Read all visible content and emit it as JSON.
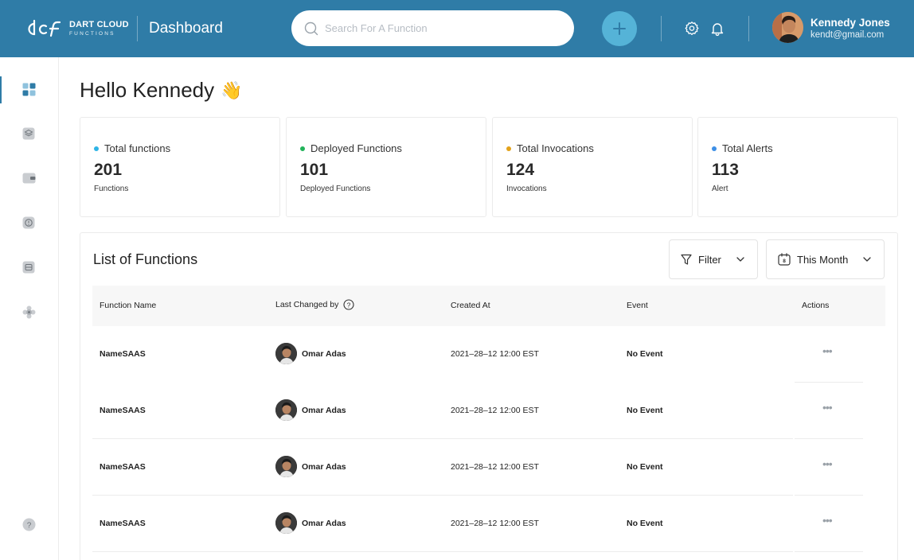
{
  "brand": {
    "line1": "DART CLOUD",
    "line2": "FUNCTIONS"
  },
  "header": {
    "page_title": "Dashboard",
    "search_placeholder": "Search For A Function",
    "user_name": "Kennedy Jones",
    "user_email": "kendt@gmail.com"
  },
  "sidebar": {
    "items": [
      {
        "icon": "dashboard-grid-icon",
        "active": true
      },
      {
        "icon": "layers-icon"
      },
      {
        "icon": "wallet-icon"
      },
      {
        "icon": "alert-circle-icon"
      },
      {
        "icon": "database-icon"
      },
      {
        "icon": "settings-cog-icon"
      },
      {
        "icon": "help-icon"
      }
    ]
  },
  "greeting": {
    "text": "Hello Kennedy",
    "emoji": "👋"
  },
  "stats": [
    {
      "title": "Total functions",
      "value": "201",
      "sub": "Functions",
      "color": "#2eb4e6"
    },
    {
      "title": "Deployed Functions",
      "value": "101",
      "sub": "Deployed Functions",
      "color": "#22b35a"
    },
    {
      "title": "Total Invocations",
      "value": "124",
      "sub": "Invocations",
      "color": "#e3a21a"
    },
    {
      "title": "Total Alerts",
      "value": "113",
      "sub": "Alert",
      "color": "#3d8fe6"
    }
  ],
  "functions": {
    "title": "List of Functions",
    "filter_label": "Filter",
    "period_label": "This Month",
    "calendar_day": "8",
    "columns": [
      "Function Name",
      "Last Changed by",
      "Created At",
      "Event",
      "Actions"
    ],
    "rows": [
      {
        "name": "NameSAAS",
        "changed_by": "Omar Adas",
        "created_at": "2021–28–12 12:00 EST",
        "event": "No Event"
      },
      {
        "name": "NameSAAS",
        "changed_by": "Omar Adas",
        "created_at": "2021–28–12 12:00 EST",
        "event": "No Event"
      },
      {
        "name": "NameSAAS",
        "changed_by": "Omar Adas",
        "created_at": "2021–28–12 12:00 EST",
        "event": "No Event"
      },
      {
        "name": "NameSAAS",
        "changed_by": "Omar Adas",
        "created_at": "2021–28–12 12:00 EST",
        "event": "No Event"
      }
    ]
  },
  "colors": {
    "header_bg": "#2f7ca7",
    "accent": "#55b3d7"
  }
}
